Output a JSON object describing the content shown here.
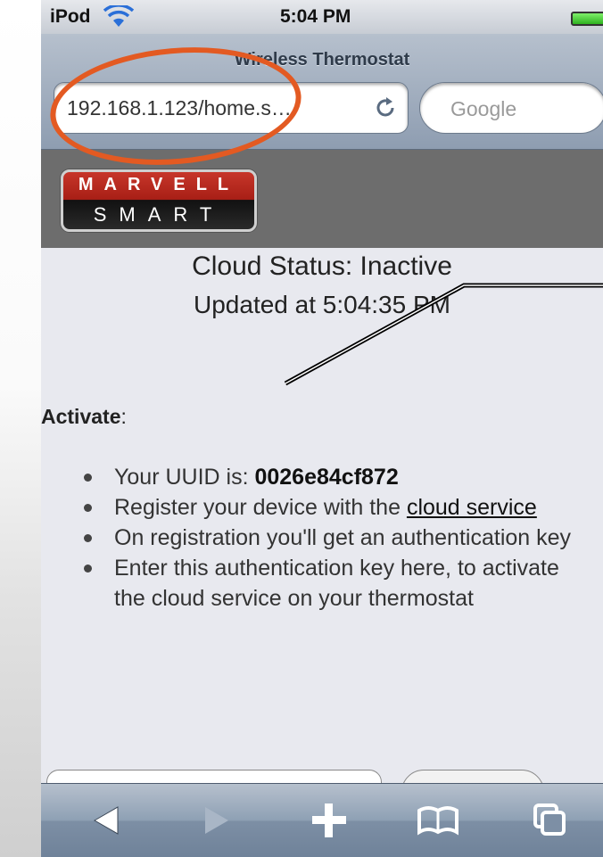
{
  "status_bar": {
    "carrier": "iPod",
    "time": "5:04 PM"
  },
  "browser": {
    "page_title": "Wireless Thermostat",
    "url": "192.168.1.123/home.s…",
    "search_placeholder": "Google"
  },
  "logo": {
    "line1": "MARVELL",
    "line2": "SMART"
  },
  "content": {
    "cloud_status": "Cloud Status: Inactive",
    "updated": "Updated at 5:04:35 PM",
    "activate_label": "Activate",
    "activate_suffix": ":",
    "steps": {
      "uuid_prefix": "Your UUID is: ",
      "uuid": "0026e84cf872",
      "register_prefix": "Register your device with the ",
      "register_link": "cloud service",
      "registration": "On registration you'll get an authentication key",
      "enter_key": "Enter this authentication key here, to activate the cloud service on your thermostat"
    }
  },
  "toolbar": {
    "back_icon": "back-arrow-icon",
    "forward_icon": "forward-arrow-icon",
    "add_icon": "plus-icon",
    "bookmarks_icon": "book-icon",
    "pages_icon": "pages-icon"
  },
  "colors": {
    "annotation": "#e35a22",
    "header_band": "#6d6d6d",
    "logo_red": "#b8271c"
  }
}
